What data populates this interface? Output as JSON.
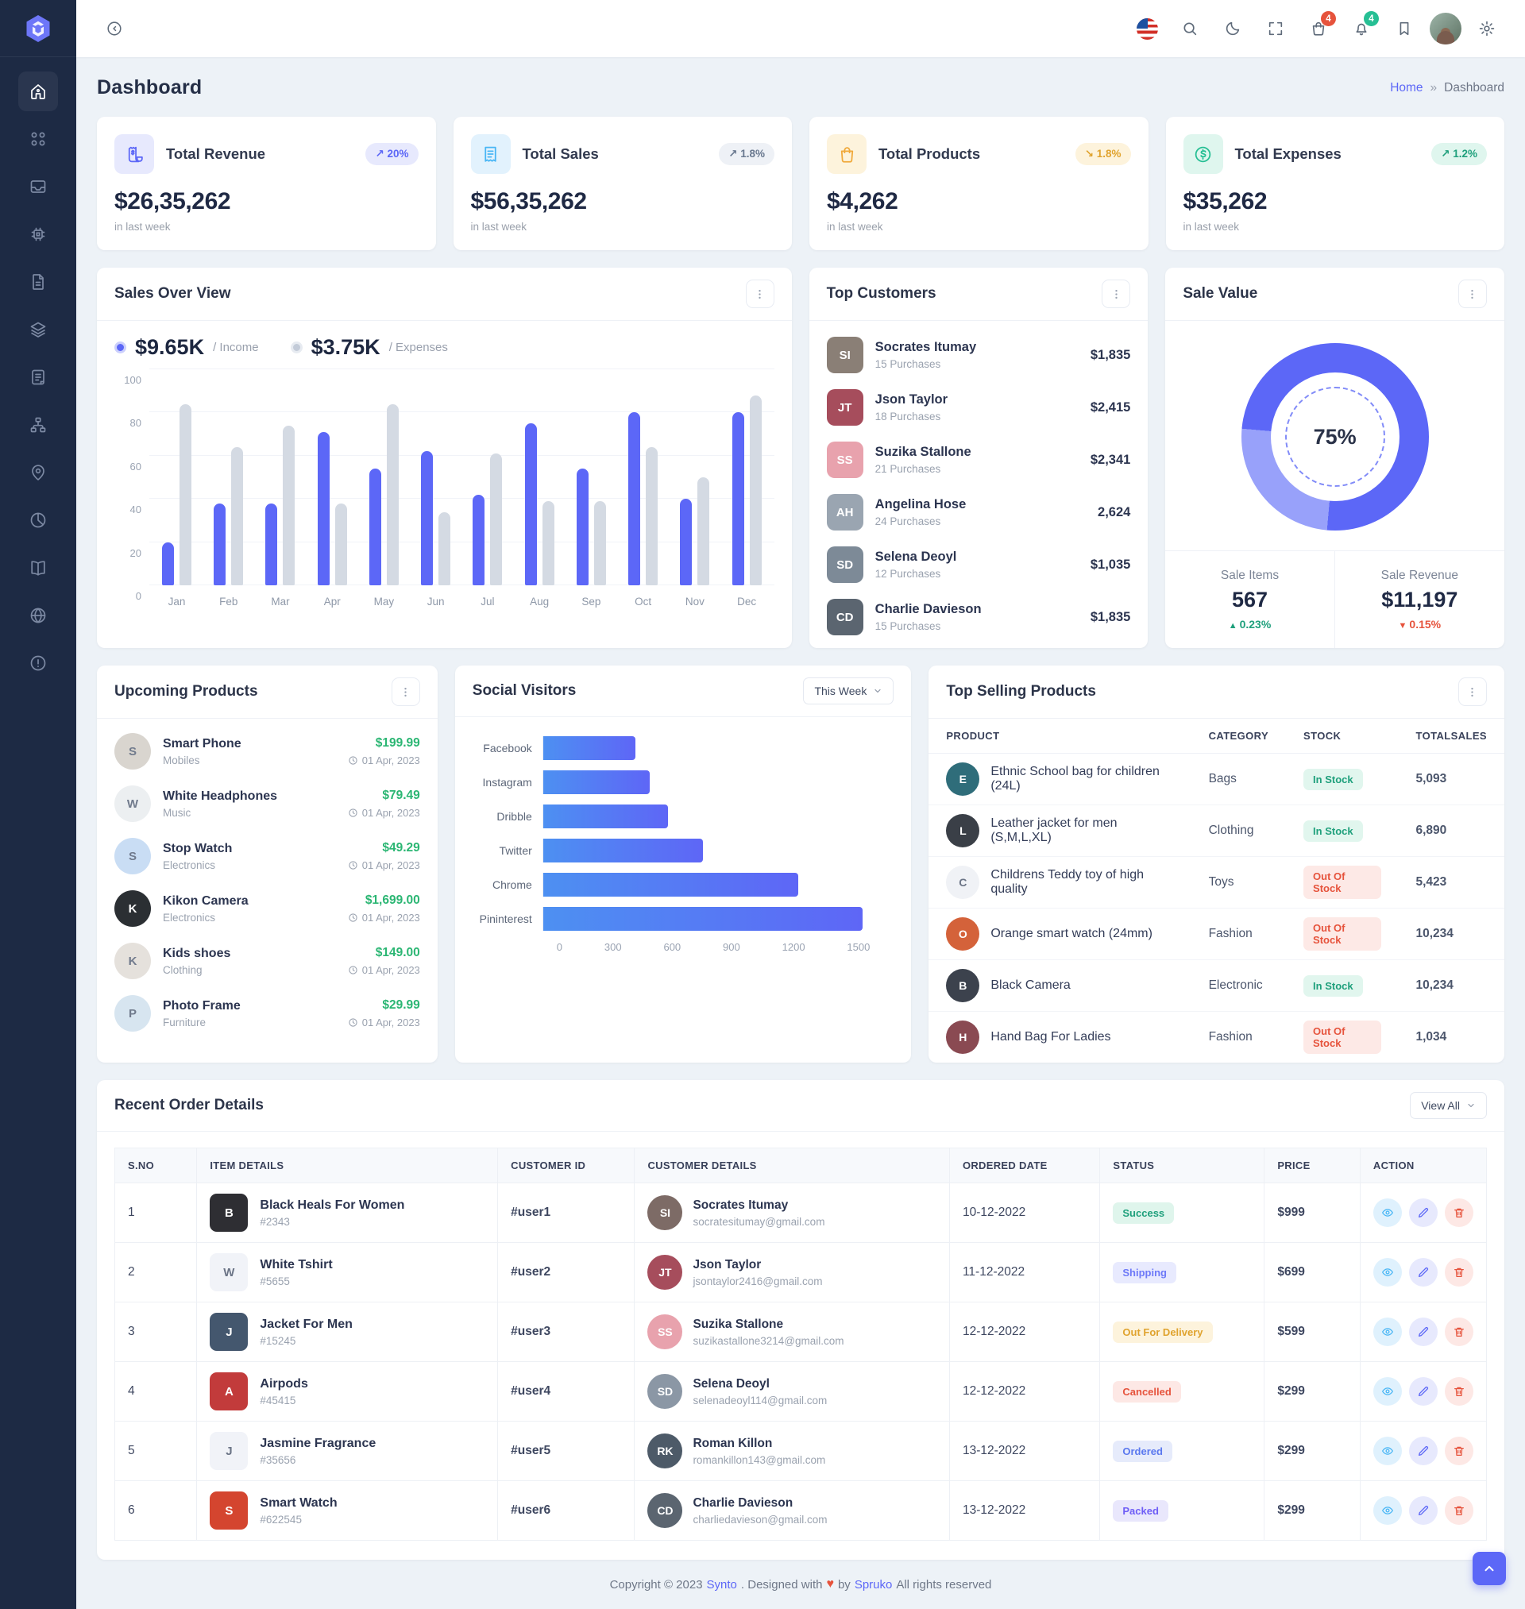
{
  "app": {
    "name": "Synto"
  },
  "colors": {
    "primary": "#5c67f7",
    "success": "#26bf94",
    "danger": "#e6533c",
    "warning": "#f5b849",
    "info": "#49b6f5",
    "sidebar_bg": "#1d2a44",
    "income_bar": "#5c67f7",
    "expense_bar": "#d4dae3"
  },
  "header": {
    "cart_badge": "4",
    "bell_badge": "4"
  },
  "page": {
    "title": "Dashboard",
    "breadcrumb_home": "Home",
    "breadcrumb_sep": "»",
    "breadcrumb_current": "Dashboard"
  },
  "stats": [
    {
      "label": "Total Revenue",
      "value": "$26,35,262",
      "period": "in last week",
      "badge": "20%",
      "arrow": "↗",
      "theme": "primary",
      "badge_theme": "primary"
    },
    {
      "label": "Total Sales",
      "value": "$56,35,262",
      "period": "in last week",
      "badge": "1.8%",
      "arrow": "↗",
      "theme": "info",
      "badge_theme": "secondary"
    },
    {
      "label": "Total Products",
      "value": "$4,262",
      "period": "in last week",
      "badge": "1.8%",
      "arrow": "↘",
      "theme": "warning",
      "badge_theme": "warning"
    },
    {
      "label": "Total Expenses",
      "value": "$35,262",
      "period": "in last week",
      "badge": "1.2%",
      "arrow": "↗",
      "theme": "success",
      "badge_theme": "success"
    }
  ],
  "sales_overview": {
    "title": "Sales Over View",
    "income_value": "$9.65K",
    "income_label": "/ Income",
    "expenses_value": "$3.75K",
    "expenses_label": "/ Expenses"
  },
  "top_customers": {
    "title": "Top Customers",
    "customers": [
      {
        "name": "Socrates Itumay",
        "purchases": "15 Purchases",
        "amount": "$1,835",
        "avatar_color": "#8a7f76"
      },
      {
        "name": "Json Taylor",
        "purchases": "18 Purchases",
        "amount": "$2,415",
        "avatar_color": "#a64d5c"
      },
      {
        "name": "Suzika Stallone",
        "purchases": "21 Purchases",
        "amount": "$2,341",
        "avatar_color": "#e8a2ad"
      },
      {
        "name": "Angelina Hose",
        "purchases": "24 Purchases",
        "amount": "2,624",
        "avatar_color": "#9aa5b1"
      },
      {
        "name": "Selena Deoyl",
        "purchases": "12 Purchases",
        "amount": "$1,035",
        "avatar_color": "#7d8a97"
      },
      {
        "name": "Charlie Davieson",
        "purchases": "15 Purchases",
        "amount": "$1,835",
        "avatar_color": "#5b6570"
      }
    ]
  },
  "sale_value": {
    "title": "Sale Value",
    "percent": "75%",
    "items_label": "Sale Items",
    "items_value": "567",
    "items_change": "0.23%",
    "items_direction": "up",
    "revenue_label": "Sale Revenue",
    "revenue_value": "$11,197",
    "revenue_change": "0.15%",
    "revenue_direction": "down"
  },
  "upcoming_products": {
    "title": "Upcoming Products",
    "products": [
      {
        "name": "Smart Phone",
        "category": "Mobiles",
        "price": "$199.99",
        "date": "01 Apr, 2023",
        "tint": "#d9d5cf"
      },
      {
        "name": "White Headphones",
        "category": "Music",
        "price": "$79.49",
        "date": "01 Apr, 2023",
        "tint": "#eceff1"
      },
      {
        "name": "Stop Watch",
        "category": "Electronics",
        "price": "$49.29",
        "date": "01 Apr, 2023",
        "tint": "#c9ddf4"
      },
      {
        "name": "Kikon Camera",
        "category": "Electronics",
        "price": "$1,699.00",
        "date": "01 Apr, 2023",
        "tint": "#2b2f33"
      },
      {
        "name": "Kids shoes",
        "category": "Clothing",
        "price": "$149.00",
        "date": "01 Apr, 2023",
        "tint": "#e5e1dc"
      },
      {
        "name": "Photo Frame",
        "category": "Furniture",
        "price": "$29.99",
        "date": "01 Apr, 2023",
        "tint": "#d7e5f0"
      }
    ]
  },
  "social_visitors": {
    "title": "Social Visitors",
    "range_label": "This Week"
  },
  "top_selling": {
    "title": "Top Selling Products",
    "headers": [
      "PRODUCT",
      "CATEGORY",
      "STOCK",
      "TOTALSALES"
    ],
    "rows": [
      {
        "product": "Ethnic School bag for children (24L)",
        "category": "Bags",
        "stock": "In Stock",
        "stock_state": "in",
        "sales": "5,093",
        "tint": "#2f6d7a"
      },
      {
        "product": "Leather jacket for men (S,M,L,XL)",
        "category": "Clothing",
        "stock": "In Stock",
        "stock_state": "in",
        "sales": "6,890",
        "tint": "#3a3f47"
      },
      {
        "product": "Childrens Teddy toy of high quality",
        "category": "Toys",
        "stock": "Out Of Stock",
        "stock_state": "out",
        "sales": "5,423",
        "tint": "#cfd8e2"
      },
      {
        "product": "Orange smart watch (24mm)",
        "category": "Fashion",
        "stock": "Out Of Stock",
        "stock_state": "out",
        "sales": "10,234",
        "tint": "#d4623a"
      },
      {
        "product": "Black Camera",
        "category": "Electronic",
        "stock": "In Stock",
        "stock_state": "in",
        "sales": "10,234",
        "tint": "#3c424d"
      },
      {
        "product": "Hand Bag For Ladies",
        "category": "Fashion",
        "stock": "Out Of Stock",
        "stock_state": "out",
        "sales": "1,034",
        "tint": "#8a4a52"
      }
    ]
  },
  "recent_orders": {
    "title": "Recent Order Details",
    "view_all_label": "View All",
    "headers": [
      "S.NO",
      "ITEM DETAILS",
      "CUSTOMER ID",
      "CUSTOMER DETAILS",
      "ORDERED DATE",
      "STATUS",
      "PRICE",
      "ACTION"
    ],
    "rows": [
      {
        "sno": "1",
        "item": "Black Heals For Women",
        "sku": "#2343",
        "item_tint": "#2e2e33",
        "customer_id": "#user1",
        "customer": "Socrates Itumay",
        "email": "socratesitumay@gmail.com",
        "date": "10-12-2022",
        "status": "Success",
        "status_key": "success",
        "price": "$999",
        "avatar_color": "#7d6b66"
      },
      {
        "sno": "2",
        "item": "White Tshirt",
        "sku": "#5655",
        "item_tint": "#e9e9e6",
        "customer_id": "#user2",
        "customer": "Json Taylor",
        "email": "jsontaylor2416@gmail.com",
        "date": "11-12-2022",
        "status": "Shipping",
        "status_key": "shipping",
        "price": "$699",
        "avatar_color": "#a64d5c"
      },
      {
        "sno": "3",
        "item": "Jacket For Men",
        "sku": "#15245",
        "item_tint": "#44576e",
        "customer_id": "#user3",
        "customer": "Suzika Stallone",
        "email": "suzikastallone3214@gmail.com",
        "date": "12-12-2022",
        "status": "Out For Delivery",
        "status_key": "warning",
        "price": "$599",
        "avatar_color": "#e8a2ad"
      },
      {
        "sno": "4",
        "item": "Airpods",
        "sku": "#45415",
        "item_tint": "#c23b3b",
        "customer_id": "#user4",
        "customer": "Selena Deoyl",
        "email": "selenadeoyl114@gmail.com",
        "date": "12-12-2022",
        "status": "Cancelled",
        "status_key": "danger",
        "price": "$299",
        "avatar_color": "#8b97a5"
      },
      {
        "sno": "5",
        "item": "Jasmine Fragrance",
        "sku": "#35656",
        "item_tint": "#e3a43b",
        "customer_id": "#user5",
        "customer": "Roman Killon",
        "email": "romankillon143@gmail.com",
        "date": "13-12-2022",
        "status": "Ordered",
        "status_key": "ordered",
        "price": "$299",
        "avatar_color": "#4d5a68"
      },
      {
        "sno": "6",
        "item": "Smart Watch",
        "sku": "#622545",
        "item_tint": "#d4452f",
        "customer_id": "#user6",
        "customer": "Charlie Davieson",
        "email": "charliedavieson@gmail.com",
        "date": "13-12-2022",
        "status": "Packed",
        "status_key": "packed",
        "price": "$299",
        "avatar_color": "#5b6570"
      }
    ]
  },
  "footer": {
    "prefix": "Copyright © 2023",
    "brand": "Synto",
    "middle": ". Designed with",
    "heart": "♥",
    "by": "by",
    "author": "Spruko",
    "suffix": "All rights reserved"
  },
  "chart_data": [
    {
      "id": "sales_over_view",
      "type": "bar",
      "title": "Sales Over View",
      "categories": [
        "Jan",
        "Feb",
        "Mar",
        "Apr",
        "May",
        "Jun",
        "Jul",
        "Aug",
        "Sep",
        "Oct",
        "Nov",
        "Dec"
      ],
      "series": [
        {
          "name": "Income",
          "color": "#5c67f7",
          "values": [
            20,
            38,
            38,
            71,
            54,
            62,
            42,
            75,
            54,
            80,
            40,
            80
          ]
        },
        {
          "name": "Expenses",
          "color": "#d4dae3",
          "values": [
            84,
            64,
            74,
            38,
            84,
            34,
            61,
            39,
            39,
            64,
            50,
            88
          ]
        }
      ],
      "ylim": [
        0,
        100
      ],
      "yticks": [
        0,
        20,
        40,
        60,
        80,
        100
      ],
      "grid": true,
      "legend_position": "top-left"
    },
    {
      "id": "social_visitors",
      "type": "bar",
      "orientation": "horizontal",
      "title": "Social Visitors",
      "categories": [
        "Facebook",
        "Instagram",
        "Dribble",
        "Twitter",
        "Chrome",
        "Pininterest"
      ],
      "values": [
        400,
        460,
        540,
        690,
        1100,
        1380
      ],
      "xlim": [
        0,
        1500
      ],
      "xticks": [
        0,
        300,
        600,
        900,
        1200,
        1500
      ],
      "grid": false
    },
    {
      "id": "sale_value",
      "type": "pie",
      "title": "Sale Value",
      "center_label": "75%",
      "segments": [
        {
          "color": "#5c67f7",
          "from_deg": 0,
          "to_deg": 185
        },
        {
          "color": "#98a1fa",
          "from_deg": 185,
          "to_deg": 275
        },
        {
          "color": "#5c67f7",
          "from_deg": 275,
          "to_deg": 360
        }
      ]
    }
  ]
}
